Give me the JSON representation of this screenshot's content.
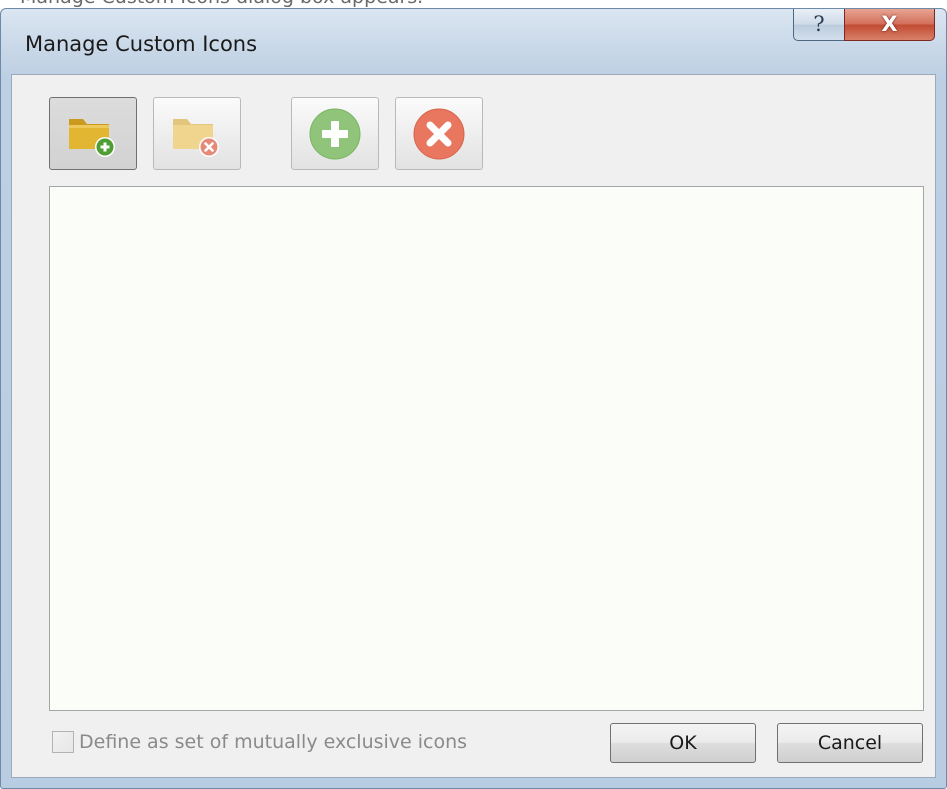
{
  "page_strip": {
    "text": "Manage Custom Icons dialog box appears."
  },
  "window": {
    "title": "Manage Custom Icons",
    "help_glyph": "?",
    "close_glyph": "X"
  },
  "toolbar": {
    "buttons": [
      {
        "icon": "folder-add-icon",
        "state": "pressed",
        "enabled": true
      },
      {
        "icon": "folder-delete-icon",
        "state": "normal",
        "enabled": false
      },
      {
        "icon": "add-circle-icon",
        "state": "normal",
        "enabled": false
      },
      {
        "icon": "remove-circle-icon",
        "state": "normal",
        "enabled": false
      }
    ]
  },
  "icon_list": {
    "items": []
  },
  "footer": {
    "checkbox_label": "Define as set of mutually exclusive icons",
    "checkbox_checked": false,
    "checkbox_enabled": false,
    "ok_label": "OK",
    "cancel_label": "Cancel"
  },
  "colors": {
    "title_bar": "#c9d8e8",
    "close_button": "#c24b33",
    "folder_yellow": "#e2b631",
    "add_green": "#6ab04c",
    "remove_red": "#e25a47",
    "list_background": "#fbfdf8"
  }
}
